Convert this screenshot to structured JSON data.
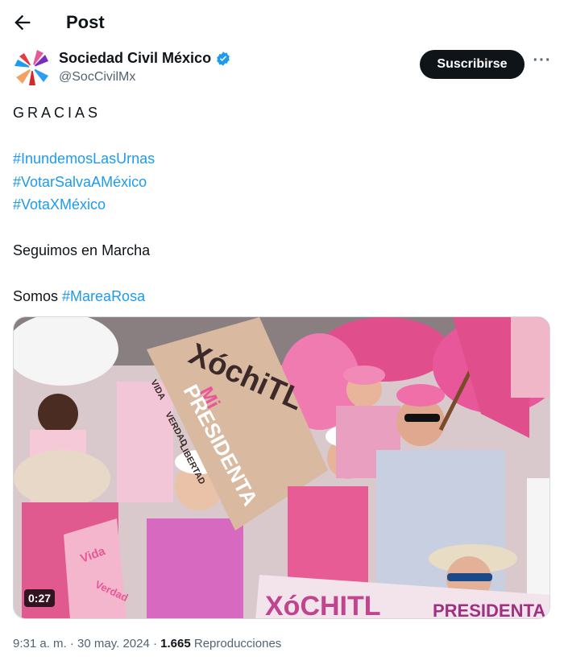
{
  "header": {
    "title": "Post",
    "back_icon": "arrow-left-icon"
  },
  "author": {
    "name": "Sociedad Civil México",
    "handle": "@SocCivilMx",
    "verified_icon": "verified-badge-icon",
    "verified_color": "#1d9bf0"
  },
  "actions": {
    "subscribe_label": "Suscribirse",
    "more_label": "···"
  },
  "tweet": {
    "line1": "GRACIAS",
    "hashtags": [
      "#InundemosLasUrnas",
      "#VotarSalvaAMéxico",
      "#VotaXMéxico"
    ],
    "line2": "Seguimos en Marcha",
    "line3_prefix": "Somos ",
    "line3_hashtag": "#MareaRosa"
  },
  "media": {
    "duration": "0:27",
    "sign_main": [
      "XóchiTL",
      "Mi",
      "PRESIDENTA"
    ],
    "sign_side": [
      "VIDA",
      "VERDAD",
      "LIBERTAD"
    ],
    "small_sign": [
      "Vida",
      "Verdad"
    ],
    "banner": [
      "XóCHITL",
      "PRESIDENTA"
    ]
  },
  "meta": {
    "time": "9:31 a. m.",
    "separator": " · ",
    "date": "30 may. 2024",
    "separator2": " · ",
    "views_count": "1.665",
    "views_label": " Reproducciones"
  },
  "colors": {
    "accent": "#1d9bf0",
    "text": "#0f1419",
    "secondary": "#536471",
    "pink": "#e8579a"
  }
}
